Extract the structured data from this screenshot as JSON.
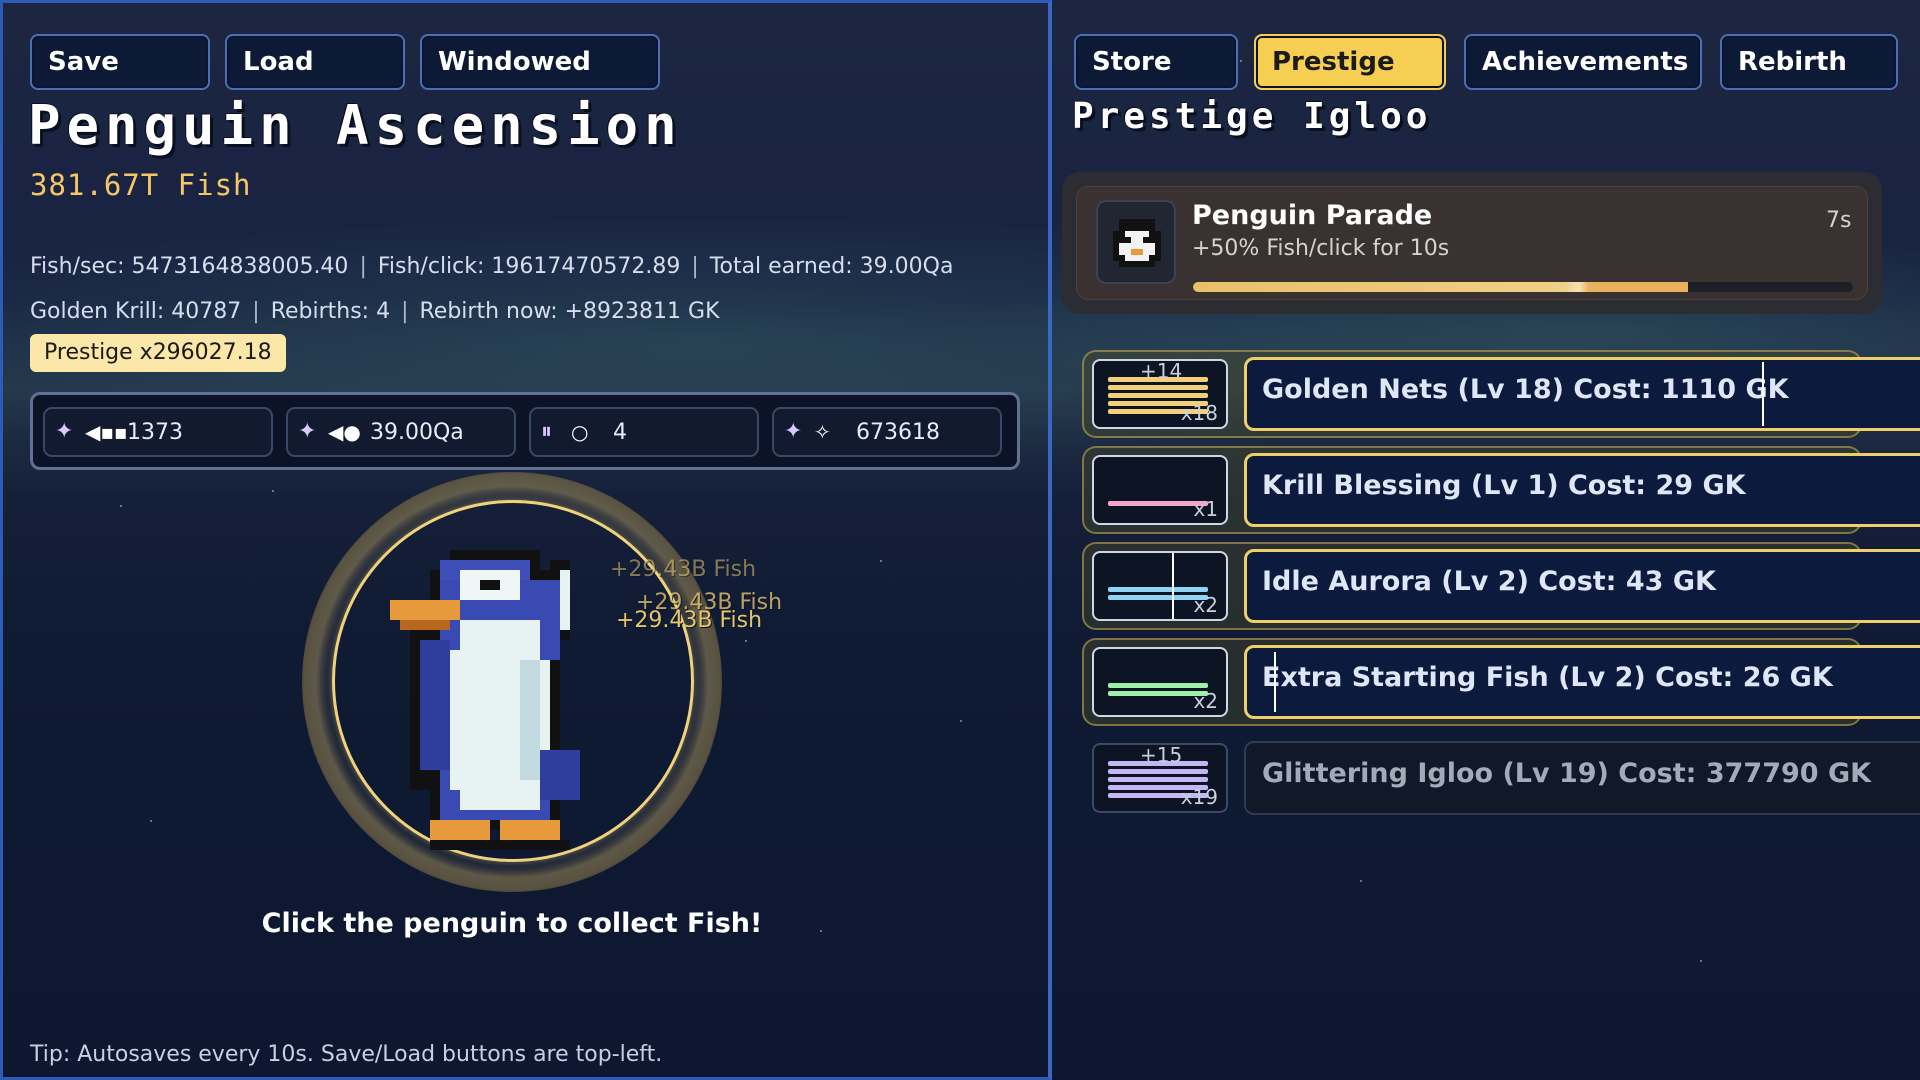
{
  "toolbar": {
    "save_label": "Save",
    "load_label": "Load",
    "windowed_label": "Windowed"
  },
  "game": {
    "title": "Penguin Ascension",
    "fish": "381.67T Fish",
    "stats_line1": {
      "fish_sec": "Fish/sec: 5473164838005.40",
      "fish_click": "Fish/click: 19617470572.89",
      "total_earned": "Total earned: 39.00Qa"
    },
    "stats_line2": {
      "golden_krill": "Golden Krill: 40787",
      "rebirths": "Rebirths: 4",
      "rebirth_now": "Rebirth now: +8923811 GK"
    },
    "separator": "|",
    "prestige_badge": "Prestige x296027.18",
    "resources": [
      {
        "icon": "sparkle-icon",
        "icon2": "fish-school-icon",
        "value": "1373"
      },
      {
        "icon": "sparkle-icon",
        "icon2": "fish-icon",
        "value": "39.00Qa"
      },
      {
        "icon": "pause-icon",
        "icon2": "refresh-icon",
        "value": "4"
      },
      {
        "icon": "sparkle-icon",
        "icon2": "star-icon",
        "value": "673618"
      }
    ],
    "floaters": [
      "+29.43B Fish",
      "+29.43B Fish",
      "+29.43B Fish"
    ],
    "cta": "Click the penguin to collect Fish!",
    "tip": "Tip: Autosaves every 10s. Save/Load buttons are top-left."
  },
  "tabs": [
    {
      "label": "Store",
      "active": false
    },
    {
      "label": "Prestige",
      "active": true
    },
    {
      "label": "Achievements",
      "active": false
    },
    {
      "label": "Rebirth",
      "active": false
    }
  ],
  "prestige": {
    "heading": "Prestige Igloo",
    "event": {
      "name": "Penguin Parade",
      "desc": "+50% Fish/click for 10s",
      "time": "7s",
      "progress": 0.75
    },
    "upgrades": [
      {
        "label": "Golden Nets  (Lv 18)  Cost: 1110 GK",
        "plus": "+14",
        "mult": "x18",
        "color": "#f3cf7a",
        "affordable": true
      },
      {
        "label": "Krill Blessing  (Lv 1)  Cost: 29 GK",
        "plus": "",
        "mult": "x1",
        "color": "#f2a6c9",
        "affordable": true
      },
      {
        "label": "Idle Aurora  (Lv 2)  Cost: 43 GK",
        "plus": "",
        "mult": "x2",
        "color": "#8fd3f5",
        "affordable": true
      },
      {
        "label": "Extra Starting Fish  (Lv 2)  Cost: 26 GK",
        "plus": "",
        "mult": "x2",
        "color": "#9ff0a8",
        "affordable": true
      },
      {
        "label": "Glittering Igloo  (Lv 19)  Cost: 377790 GK",
        "plus": "+15",
        "mult": "x19",
        "color": "#c3b6f2",
        "affordable": false
      }
    ]
  },
  "colors": {
    "accent": "#f6cf52",
    "panel_border": "#2c5bb8",
    "gold_text": "#f3c766",
    "background": "#0f1a33"
  }
}
